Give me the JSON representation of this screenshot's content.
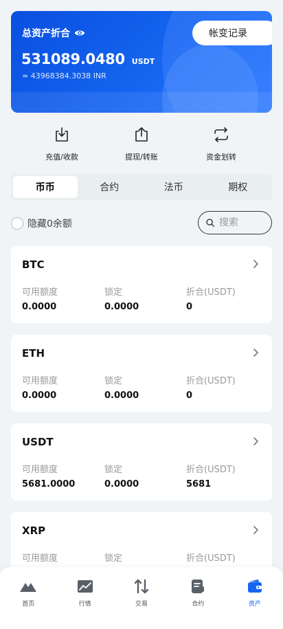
{
  "hero": {
    "title": "总资产折合",
    "amount": "531089.0480",
    "unit": "USDT",
    "fiat_equiv": "≈ 43968384.3038 INR",
    "record_button": "帐变记录"
  },
  "actions": [
    {
      "label": "充值/收款",
      "icon": "download-icon"
    },
    {
      "label": "提现/转账",
      "icon": "upload-icon"
    },
    {
      "label": "资金划转",
      "icon": "transfer-icon"
    }
  ],
  "tabs": [
    {
      "label": "币币",
      "active": true
    },
    {
      "label": "合约",
      "active": false
    },
    {
      "label": "法币",
      "active": false
    },
    {
      "label": "期权",
      "active": false
    }
  ],
  "filter": {
    "hide_zero_label": "隐藏0余额",
    "search_placeholder": "搜索"
  },
  "columns": {
    "available": "可用额度",
    "locked": "锁定",
    "converted": "折合(USDT)"
  },
  "assets": [
    {
      "symbol": "BTC",
      "available": "0.0000",
      "locked": "0.0000",
      "converted": "0"
    },
    {
      "symbol": "ETH",
      "available": "0.0000",
      "locked": "0.0000",
      "converted": "0"
    },
    {
      "symbol": "USDT",
      "available": "5681.0000",
      "locked": "0.0000",
      "converted": "5681"
    },
    {
      "symbol": "XRP",
      "available": "",
      "locked": "",
      "converted": ""
    }
  ],
  "nav": [
    {
      "label": "首页",
      "icon": "home-icon",
      "active": false
    },
    {
      "label": "行情",
      "icon": "market-icon",
      "active": false
    },
    {
      "label": "交易",
      "icon": "trade-icon",
      "active": false
    },
    {
      "label": "合约",
      "icon": "contract-icon",
      "active": false
    },
    {
      "label": "资产",
      "icon": "wallet-icon",
      "active": true
    }
  ],
  "colors": {
    "primary": "#1565f0",
    "background": "#f1f4f6"
  }
}
